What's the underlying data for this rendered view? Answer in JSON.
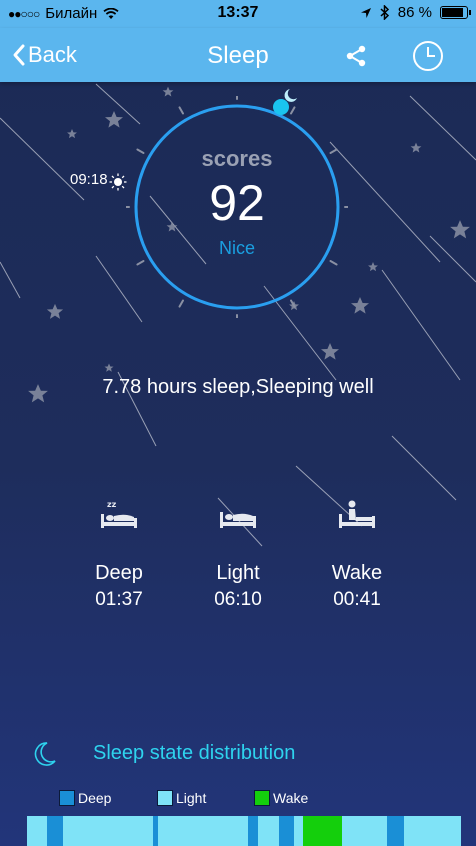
{
  "status_bar": {
    "carrier": "Билайн",
    "time": "13:37",
    "battery": "86 %",
    "battery_level": 0.86
  },
  "nav": {
    "back_label": "Back",
    "title": "Sleep",
    "share_icon": "share-icon",
    "clock_icon": "clock-icon"
  },
  "score": {
    "label": "scores",
    "value": "92",
    "grade": "Nice",
    "bedtime": "09:18",
    "ring_color": "#2a9ff0"
  },
  "summary": "7.78 hours sleep,Sleeping well",
  "stats": [
    {
      "label": "Deep",
      "value": "01:37",
      "icon": "sleeping-bed-icon"
    },
    {
      "label": "Light",
      "value": "06:10",
      "icon": "bed-icon"
    },
    {
      "label": "Wake",
      "value": "00:41",
      "icon": "sitting-up-bed-icon"
    }
  ],
  "distribution": {
    "title": "Sleep state distribution",
    "legend": [
      {
        "label": "Deep",
        "color": "#1a8fd6"
      },
      {
        "label": "Light",
        "color": "#7fe3f7"
      },
      {
        "label": "Wake",
        "color": "#14cf0c"
      }
    ],
    "segments": [
      {
        "state": "Light",
        "fraction": 0.045
      },
      {
        "state": "Deep",
        "fraction": 0.038
      },
      {
        "state": "Light",
        "fraction": 0.207
      },
      {
        "state": "Deep",
        "fraction": 0.012
      },
      {
        "state": "Light",
        "fraction": 0.208
      },
      {
        "state": "Deep",
        "fraction": 0.022
      },
      {
        "state": "Light",
        "fraction": 0.048
      },
      {
        "state": "Deep",
        "fraction": 0.035
      },
      {
        "state": "Light",
        "fraction": 0.02
      },
      {
        "state": "Wake",
        "fraction": 0.09
      },
      {
        "state": "Light",
        "fraction": 0.105
      },
      {
        "state": "Deep",
        "fraction": 0.038
      },
      {
        "state": "Light",
        "fraction": 0.132
      }
    ]
  }
}
